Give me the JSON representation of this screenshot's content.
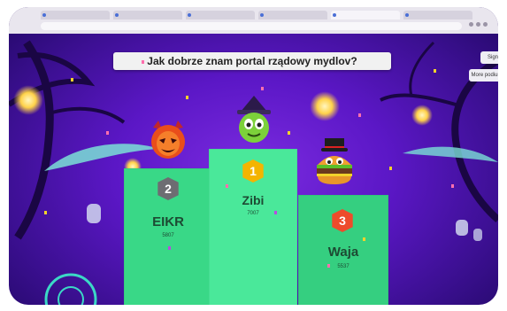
{
  "browser": {
    "tabs": [
      "",
      "",
      "",
      "",
      "",
      "",
      ""
    ],
    "url": ""
  },
  "quiz": {
    "title": "Jak dobrze znam portal rządowy mydlov?"
  },
  "side_buttons": [
    "Sign",
    "More podium"
  ],
  "podium": [
    {
      "rank": "2",
      "name": "EIKR",
      "score": "5807",
      "avatar": "devil-avatar-icon",
      "badge_color": "#6d6d72"
    },
    {
      "rank": "1",
      "name": "Zibi",
      "score": "7007",
      "avatar": "witch-avatar-icon",
      "badge_color": "#f4b400"
    },
    {
      "rank": "3",
      "name": "Waja",
      "score": "5537",
      "avatar": "burger-avatar-icon",
      "badge_color": "#ee4b2b"
    }
  ],
  "colors": {
    "background": "#5b17c6",
    "podium_green": "#3fe08c"
  }
}
